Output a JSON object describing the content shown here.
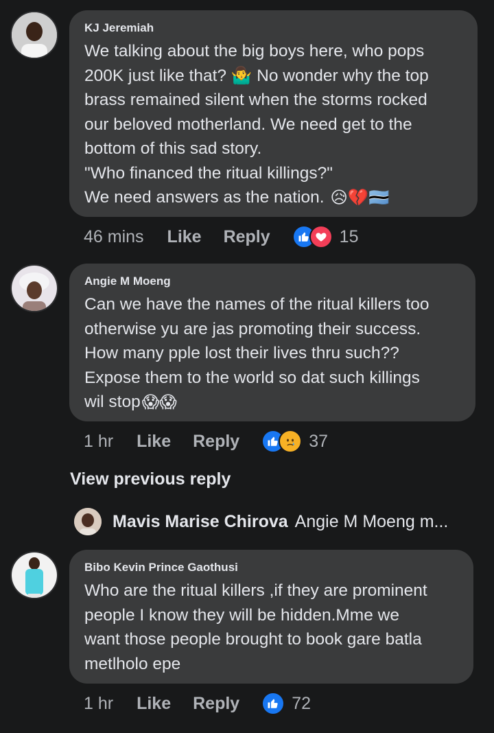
{
  "comments": [
    {
      "author": "KJ Jeremiah",
      "lines": [
        "We talking about the big boys here, who pops",
        "200K just like that? 🤷‍♂️ No wonder why the top",
        "brass remained silent when the storms rocked",
        "our beloved motherland. We need get to the",
        "bottom of this sad story.",
        "\"Who financed the ritual killings?\"",
        "We need answers as the nation."
      ],
      "trailing_emoji": "😥💔🇧🇼",
      "time": "46 mins",
      "like_label": "Like",
      "reply_label": "Reply",
      "reactions": [
        "like-reaction",
        "love-reaction"
      ],
      "reaction_count": "15"
    },
    {
      "author": "Angie M Moeng",
      "lines": [
        "Can we have the names of the ritual killers too",
        "otherwise yu are jas promoting their success.",
        "How many pple lost their lives thru such??",
        "Expose them to the world so dat such killings",
        "wil stop"
      ],
      "trailing_emoji": "😱😱",
      "time": "1 hr",
      "like_label": "Like",
      "reply_label": "Reply",
      "reactions": [
        "like-reaction",
        "sad-reaction"
      ],
      "reaction_count": "37"
    },
    {
      "author": "Bibo Kevin Prince Gaothusi",
      "lines": [
        "Who are the ritual killers ,if they are prominent",
        "people I know they will be hidden.Mme we",
        "want those people brought to book gare batla",
        "metlholo epe"
      ],
      "trailing_emoji": "",
      "time": "1 hr",
      "like_label": "Like",
      "reply_label": "Reply",
      "reactions": [
        "like-reaction"
      ],
      "reaction_count": "72"
    }
  ],
  "view_previous": "View previous reply",
  "collapsed_reply": {
    "name": "Mavis Marise Chirova",
    "snippet": "Angie M Moeng m..."
  },
  "colors": {
    "background": "#18191a",
    "bubble": "#3a3b3c",
    "like_blue": "#1877f2",
    "love_red": "#f33e58",
    "sad_yellow": "#f7b125",
    "secondary_text": "#b0b3b8"
  }
}
